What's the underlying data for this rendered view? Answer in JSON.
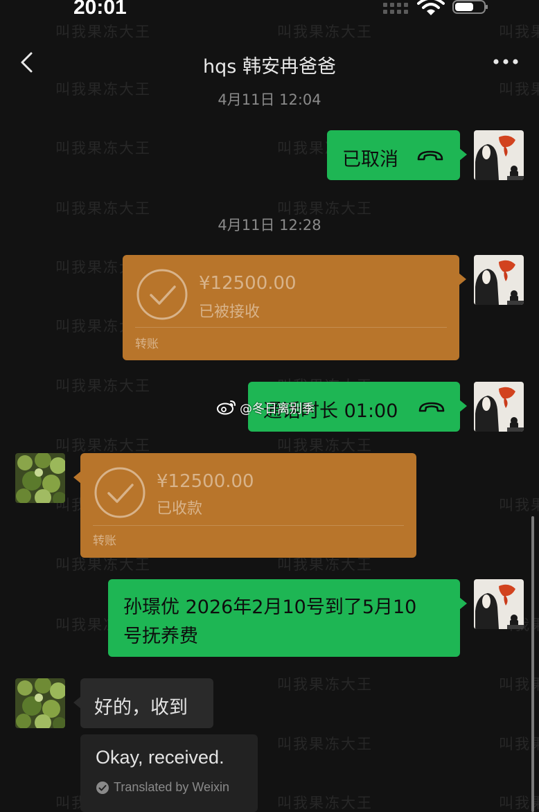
{
  "status_bar": {
    "time": "20:01"
  },
  "header": {
    "title": "hqs 韩安冉爸爸"
  },
  "watermark": {
    "text": "叫我果冻大王"
  },
  "messages": [
    {
      "type": "timestamp",
      "text": "4月11日 12:04"
    },
    {
      "type": "call",
      "side": "sent",
      "text": "已取消",
      "icon": "phone-hangup-icon"
    },
    {
      "type": "timestamp",
      "text": "4月11日 12:28"
    },
    {
      "type": "transfer",
      "side": "sent",
      "amount": "¥12500.00",
      "status": "已被接收",
      "label": "转账",
      "icon": "check-circle-icon"
    },
    {
      "type": "call",
      "side": "sent",
      "text": "通话时长 01:00",
      "icon": "phone-hangup-icon"
    },
    {
      "type": "transfer",
      "side": "received",
      "amount": "¥12500.00",
      "status": "已收款",
      "label": "转账",
      "icon": "check-circle-icon"
    },
    {
      "type": "text",
      "side": "sent",
      "lines": [
        "孙璟优 2026年2月10号到了5月10",
        "号抚养费"
      ]
    },
    {
      "type": "text",
      "side": "received",
      "text": "好的，收到"
    }
  ],
  "translation": {
    "text": "Okay, received.",
    "credit": "Translated by Weixin"
  },
  "weibo_overlay": {
    "text": "@冬日离别季",
    "icon": "weibo-icon"
  },
  "colors": {
    "background": "#121212",
    "sent_bubble": "#1eb654",
    "transfer_bubble": "#b8752b",
    "received_bubble": "#2a2a2a"
  }
}
